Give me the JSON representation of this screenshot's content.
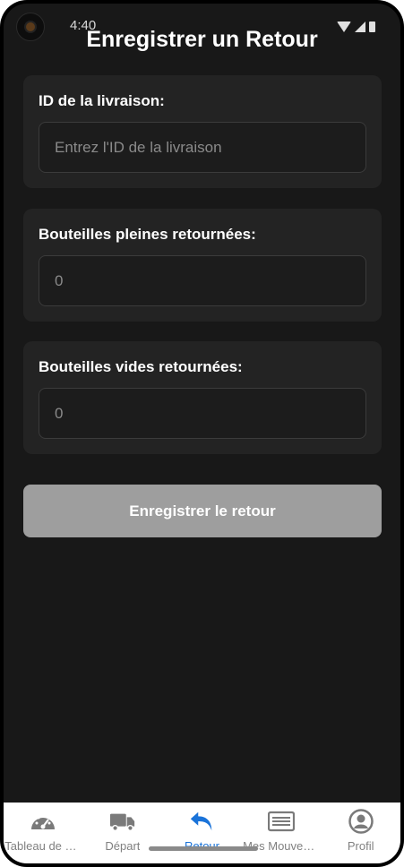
{
  "status_bar": {
    "time": "4:40"
  },
  "page": {
    "title": "Enregistrer un Retour"
  },
  "form": {
    "delivery_id": {
      "label": "ID de la livraison:",
      "placeholder": "Entrez l'ID de la livraison",
      "value": ""
    },
    "full_bottles": {
      "label": "Bouteilles pleines retournées:",
      "placeholder": "0",
      "value": ""
    },
    "empty_bottles": {
      "label": "Bouteilles vides retournées:",
      "placeholder": "0",
      "value": ""
    },
    "submit_label": "Enregistrer le retour"
  },
  "tabs": [
    {
      "label": "Tableau de bord",
      "icon": "dashboard-icon",
      "active": false
    },
    {
      "label": "Départ",
      "icon": "truck-icon",
      "active": false
    },
    {
      "label": "Retour",
      "icon": "return-arrow-icon",
      "active": true
    },
    {
      "label": "Mes Mouvements",
      "icon": "list-icon",
      "active": false
    },
    {
      "label": "Profil",
      "icon": "profile-icon",
      "active": false
    }
  ],
  "colors": {
    "background": "#181818",
    "card": "#232323",
    "button_disabled": "#9e9e9e",
    "active_tab": "#1a73d9",
    "inactive_tab": "#808080"
  }
}
